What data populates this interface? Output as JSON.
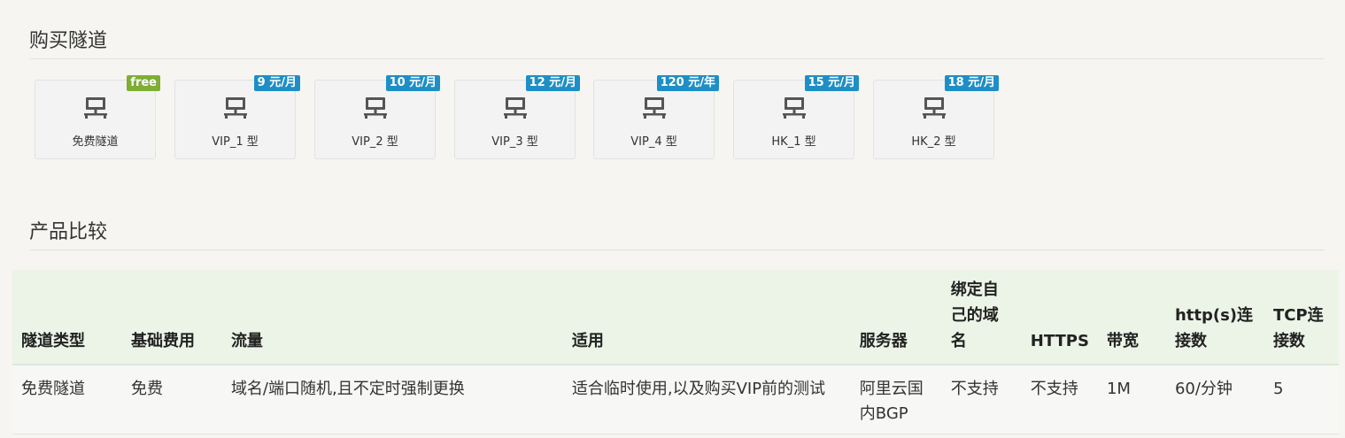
{
  "buy_section": {
    "title": "购买隧道"
  },
  "cards": [
    {
      "name": "免费隧道",
      "badge": "free"
    },
    {
      "name": "VIP_1 型",
      "badge": "9 元/月"
    },
    {
      "name": "VIP_2 型",
      "badge": "10 元/月"
    },
    {
      "name": "VIP_3 型",
      "badge": "12 元/月"
    },
    {
      "name": "VIP_4 型",
      "badge": "120 元/年"
    },
    {
      "name": "HK_1 型",
      "badge": "15 元/月"
    },
    {
      "name": "HK_2 型",
      "badge": "18 元/月"
    }
  ],
  "compare_section": {
    "title": "产品比较"
  },
  "table": {
    "headers": [
      "隧道类型",
      "基础费用",
      "流量",
      "适用",
      "服务器",
      "绑定自己的域名",
      "HTTPS",
      "带宽",
      "http(s)连接数",
      "TCP连接数"
    ],
    "rows": [
      [
        "免费隧道",
        "免费",
        "域名/端口随机,且不定时强制更换",
        "适合临时使用,以及购买VIP前的测试",
        "阿里云国内BGP",
        "不支持",
        "不支持",
        "1M",
        "60/分钟",
        "5"
      ]
    ]
  },
  "colors": {
    "badge_free": "#7fae34",
    "badge_paid": "#1e8fc6",
    "table_header_bg": "#ebf4e6"
  },
  "icons": {
    "card_icon": "server-terminal-icon"
  }
}
